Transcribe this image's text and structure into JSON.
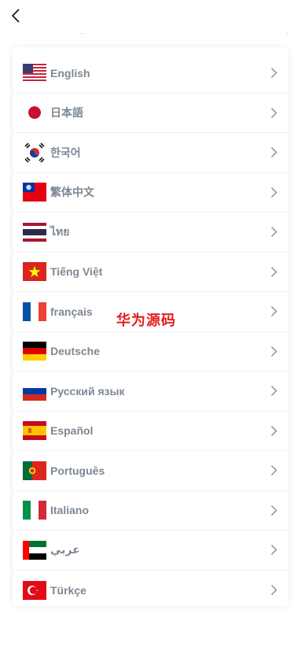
{
  "header": {
    "back_icon": "chevron-left-icon"
  },
  "languages": [
    {
      "label": "English",
      "flag": "us-flag-icon"
    },
    {
      "label": "日本語",
      "flag": "japan-flag-icon"
    },
    {
      "label": "한국어",
      "flag": "korea-flag-icon"
    },
    {
      "label": "繁体中文",
      "flag": "taiwan-flag-icon"
    },
    {
      "label": "ไทย",
      "flag": "thailand-flag-icon"
    },
    {
      "label": "Tiếng Việt",
      "flag": "vietnam-flag-icon"
    },
    {
      "label": "français",
      "flag": "france-flag-icon"
    },
    {
      "label": "Deutsche",
      "flag": "germany-flag-icon"
    },
    {
      "label": "Русский язык",
      "flag": "russia-flag-icon"
    },
    {
      "label": "Español",
      "flag": "spain-flag-icon"
    },
    {
      "label": "Português",
      "flag": "portugal-flag-icon"
    },
    {
      "label": "Italiano",
      "flag": "italy-flag-icon"
    },
    {
      "label": "عربي",
      "flag": "uae-flag-icon"
    },
    {
      "label": "Türkçe",
      "flag": "turkey-flag-icon"
    }
  ],
  "watermark": "华为源码",
  "colors": {
    "label": "#7c8894",
    "chevron": "#8a929a",
    "watermark": "#e02020"
  }
}
